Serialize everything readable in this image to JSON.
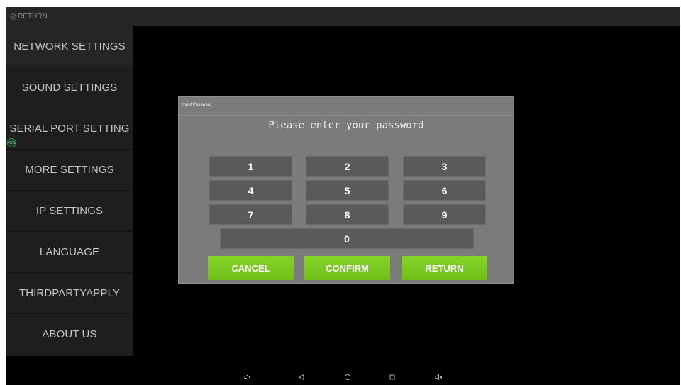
{
  "topbar": {
    "return_label": "RETURN"
  },
  "sidebar": {
    "items": [
      {
        "label": "NETWORK SETTINGS"
      },
      {
        "label": "SOUND SETTINGS"
      },
      {
        "label": "SERIAL PORT SETTING"
      },
      {
        "label": "MORE SETTINGS"
      },
      {
        "label": "IP SETTINGS"
      },
      {
        "label": "LANGUAGE"
      },
      {
        "label": "THIRDPARTYAPPLY"
      },
      {
        "label": "ABOUT US"
      }
    ],
    "badge_text": "45%"
  },
  "dialog": {
    "title": "Input Password",
    "prompt": "Please enter your password",
    "keys": [
      "1",
      "2",
      "3",
      "4",
      "5",
      "6",
      "7",
      "8",
      "9",
      "0"
    ],
    "cancel_label": "CANCEL",
    "confirm_label": "CONFIRM",
    "return_label": "RETURN"
  },
  "navbar": {
    "icons": [
      "volume-down-icon",
      "back-icon",
      "home-icon",
      "recents-icon",
      "volume-up-icon"
    ]
  },
  "colors": {
    "accent_green": "#7ed321",
    "dialog_bg": "#7b7b7b",
    "key_bg": "#5a5a5a",
    "sidebar_bg": "#1e1e1e",
    "screen_bg": "#000000"
  }
}
